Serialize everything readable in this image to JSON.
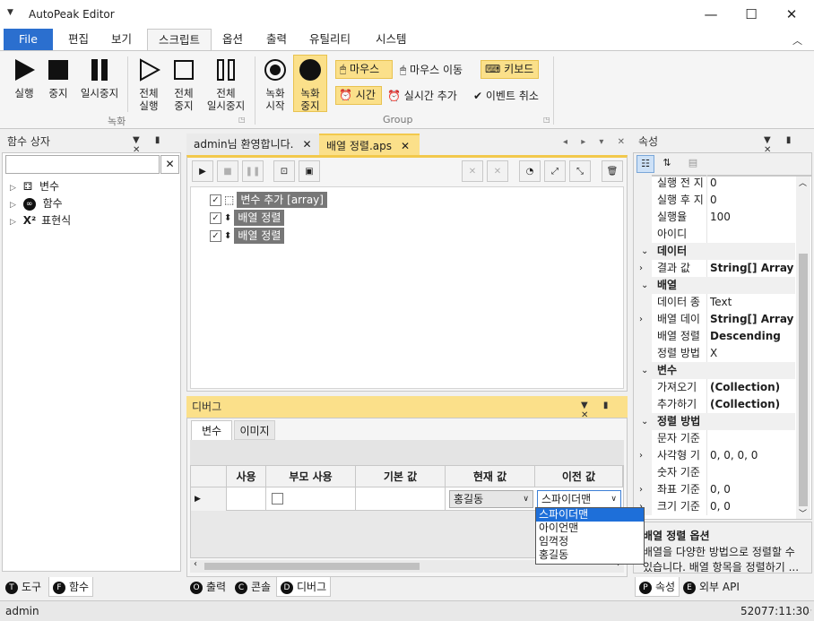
{
  "window": {
    "title": "AutoPeak Editor",
    "minimize": "—",
    "maximize": "☐",
    "close": "✕"
  },
  "ribbon_tabs": [
    "File",
    "편집",
    "보기",
    "스크립트",
    "옵션",
    "출력",
    "유틸리티",
    "시스템"
  ],
  "ribbon": {
    "run": "실행",
    "stop": "중지",
    "pause": "일시중지",
    "run_all_1": "전체",
    "run_all_2": "실행",
    "stop_all_1": "전체",
    "stop_all_2": "중지",
    "pause_all_1": "전체",
    "pause_all_2": "일시중지",
    "group_record": "녹화",
    "rec_start_1": "녹화",
    "rec_start_2": "시작",
    "rec_stop_1": "녹화",
    "rec_stop_2": "중지",
    "mouse": "마우스",
    "mouse_move": "마우스 이동",
    "keyboard": "키보드",
    "time": "시간",
    "realtime_add": "실시간 추가",
    "event_cancel": "이벤트 취소",
    "group_group": "Group"
  },
  "left_pane": {
    "title": "함수 상자",
    "search_value": "",
    "items": [
      "변수",
      "함수",
      "표현식"
    ],
    "bottom_tabs": [
      {
        "key": "T",
        "label": "도구"
      },
      {
        "key": "F",
        "label": "함수"
      }
    ]
  },
  "doc_tabs": [
    {
      "label": "admin님 환영합니다."
    },
    {
      "label": "배열 정렬.aps"
    }
  ],
  "script_nodes": [
    {
      "label": "변수 추가 [array]"
    },
    {
      "label": "배열 정렬"
    },
    {
      "label": "배열 정렬"
    }
  ],
  "debug": {
    "title": "디버그",
    "tabs": [
      "변수",
      "이미지"
    ],
    "columns": [
      "사용",
      "부모 사용",
      "기본 값",
      "현재 값",
      "이전 값"
    ],
    "row": {
      "current": "홍길동",
      "previous": "스파이더맨"
    },
    "dropdown_options": [
      "스파이더맨",
      "아이언맨",
      "임꺽정",
      "홍길동"
    ],
    "bottom_tabs": [
      {
        "key": "O",
        "label": "출력"
      },
      {
        "key": "C",
        "label": "콘솔"
      },
      {
        "key": "D",
        "label": "디버그"
      }
    ]
  },
  "properties": {
    "title": "속성",
    "rows": [
      {
        "type": "prop",
        "name": "실행 전 지",
        "value": "0",
        "expand": false
      },
      {
        "type": "prop",
        "name": "실행 후 지",
        "value": "0",
        "expand": false
      },
      {
        "type": "prop",
        "name": "실행율",
        "value": "100",
        "expand": false
      },
      {
        "type": "prop",
        "name": "아이디",
        "value": "",
        "expand": false
      },
      {
        "type": "cat",
        "name": "데이터"
      },
      {
        "type": "prop",
        "name": "결과 값",
        "value": "String[] Array",
        "expand": true,
        "bold": true
      },
      {
        "type": "cat",
        "name": "배열"
      },
      {
        "type": "prop",
        "name": "데이터 종",
        "value": "Text",
        "expand": false
      },
      {
        "type": "prop",
        "name": "배열 데이",
        "value": "String[] Array",
        "expand": true,
        "bold": true
      },
      {
        "type": "prop",
        "name": "배열 정렬",
        "value": "Descending",
        "expand": false,
        "bold": true
      },
      {
        "type": "prop",
        "name": "정렬 방법",
        "value": "X",
        "expand": false
      },
      {
        "type": "cat",
        "name": "변수"
      },
      {
        "type": "prop",
        "name": "가져오기",
        "value": "(Collection)",
        "expand": false,
        "bold": true
      },
      {
        "type": "prop",
        "name": "추가하기",
        "value": "(Collection)",
        "expand": false,
        "bold": true
      },
      {
        "type": "cat",
        "name": "정렬 방법"
      },
      {
        "type": "prop",
        "name": "문자 기준",
        "value": "",
        "expand": false
      },
      {
        "type": "prop",
        "name": "사각형 기",
        "value": "0, 0, 0, 0",
        "expand": true
      },
      {
        "type": "prop",
        "name": "숫자 기준",
        "value": "",
        "expand": false
      },
      {
        "type": "prop",
        "name": "좌표 기준",
        "value": "0, 0",
        "expand": true
      },
      {
        "type": "prop",
        "name": "크기 기준",
        "value": "0, 0",
        "expand": true
      }
    ],
    "desc_title": "배열 정렬 옵션",
    "desc_line1": "배열을 다양한 방법으로 정렬할 수",
    "desc_line2": "있습니다. 배열 항목을 정렬하기 ...",
    "bottom_tabs": [
      {
        "key": "P",
        "label": "속성"
      },
      {
        "key": "E",
        "label": "외부 API"
      }
    ]
  },
  "status": {
    "user": "admin",
    "time": "52077:11:30"
  }
}
